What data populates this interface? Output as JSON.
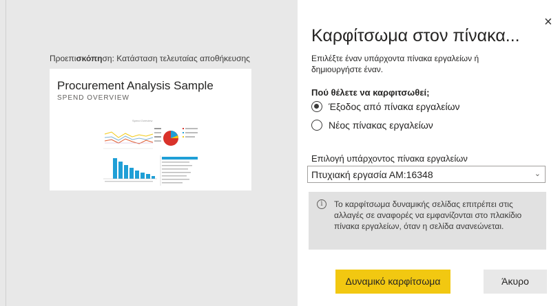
{
  "preview": {
    "label_prefix": "Προεπι",
    "label_bold": "σκόπη",
    "label_mid": "ση",
    "label_rest": ": Κατάσταση τελευταίας αποθήκευσης",
    "thumbnail": {
      "title": "Procurement Analysis Sample",
      "subtitle": "SPEND OVERVIEW",
      "chart_caption": "Spend Overview"
    }
  },
  "dialog": {
    "title": "Καρφίτσωμα στον πίνακα...",
    "description": "Επιλέξτε έναν υπάρχοντα πίνακα εργαλείων ή δημιουργήστε έναν.",
    "where_label": "Πού θέλετε να καρφιτσωθεί;",
    "options": [
      {
        "label": "Έξοδος από πίνακα εργαλείων",
        "selected": true
      },
      {
        "label": "Νέος πίνακας εργαλείων",
        "selected": false
      }
    ],
    "select_label": "Επιλογή υπάρχοντος πίνακα εργαλείων",
    "select_value": "Πτυχιακή εργασία ΑΜ:16348",
    "info_icon": "info-icon",
    "info_text": "Το καρφίτσωμα δυναμικής σελίδας επιτρέπει στις αλλαγές σε αναφορές να εμφανίζονται στο πλακίδιο πίνακα εργαλείων, όταν η σελίδα ανανεώνεται.",
    "primary_button": "Δυναμικό καρφίτσωμα",
    "cancel_button": "Άκυρο",
    "close_glyph": "×"
  },
  "colors": {
    "accent": "#f2c811",
    "left_background": "#e8e8e8",
    "info_background": "#e1e1e1"
  }
}
